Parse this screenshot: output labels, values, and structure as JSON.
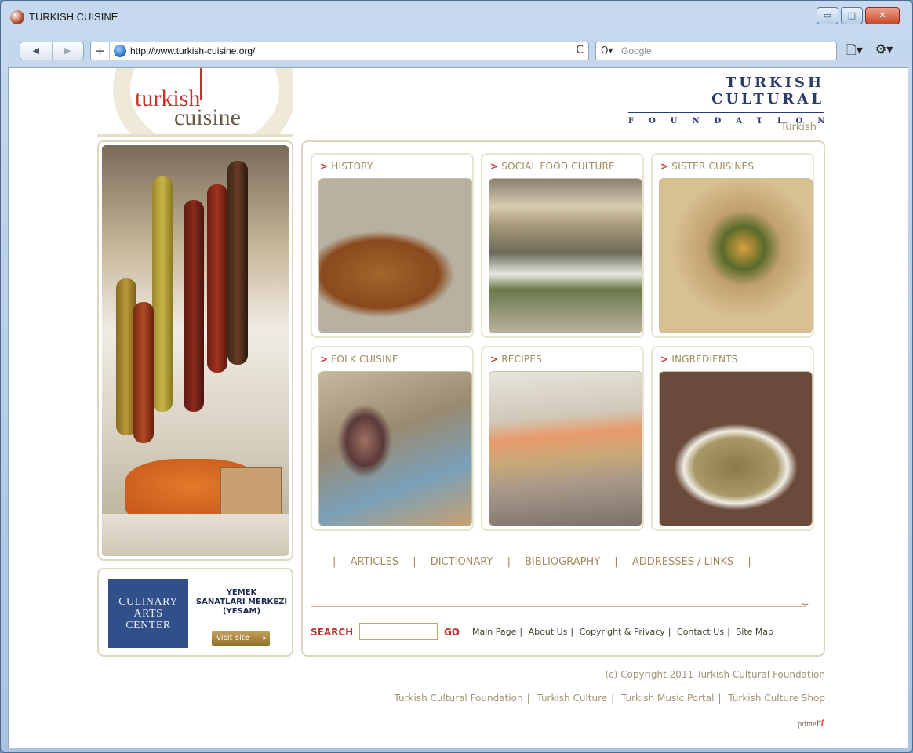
{
  "window": {
    "title": "TURKISH CUISINE",
    "controls": [
      "▭",
      "□",
      "✕"
    ]
  },
  "navbar": {
    "back": "◀",
    "forward": "▶",
    "add": "+",
    "url": "http://www.turkish-cuisine.org/",
    "reload": "C",
    "search_glyph": "Q▾",
    "search_placeholder": "Google",
    "page_menu": "🗋▾",
    "tools_menu": "⚙▾"
  },
  "header": {
    "logo_word1": "turkish",
    "logo_word2": "cuisine",
    "org_line1": "TURKISH CULTURAL",
    "org_line2": "FOUNDATION",
    "language": "Turkish"
  },
  "sidebar": {
    "cac_line1": "CULINARY",
    "cac_line2": "ARTS",
    "cac_line3": "CENTER",
    "yemek_line1": "YEMEK",
    "yemek_line2": "SANATLARI MERKEZI",
    "yemek_line3": "(YESAM)",
    "visit_label": "visit site"
  },
  "cards": [
    {
      "label": "HISTORY"
    },
    {
      "label": "SOCIAL FOOD CULTURE"
    },
    {
      "label": "SISTER CUISINES"
    },
    {
      "label": "FOLK CUISINE"
    },
    {
      "label": "RECIPES"
    },
    {
      "label": "INGREDIENTS"
    }
  ],
  "bottom_nav": {
    "items": [
      "ARTICLES",
      "DICTIONARY",
      "BIBLIOGRAPHY",
      "ADDRESSES / LINKS"
    ]
  },
  "search": {
    "label": "SEARCH",
    "go": "GO"
  },
  "footer_links": [
    "Main Page",
    "About Us",
    "Copyright & Privacy",
    "Contact Us",
    "Site Map"
  ],
  "copyright": "(c) Copyright 2011 Turkish Cultural Foundation",
  "sites": [
    "Turkish Cultural Foundation",
    "Turkish Culture",
    "Turkish Music Portal",
    "Turkish Culture Shop"
  ],
  "credit": {
    "text": "prime",
    "mark": "rt"
  }
}
